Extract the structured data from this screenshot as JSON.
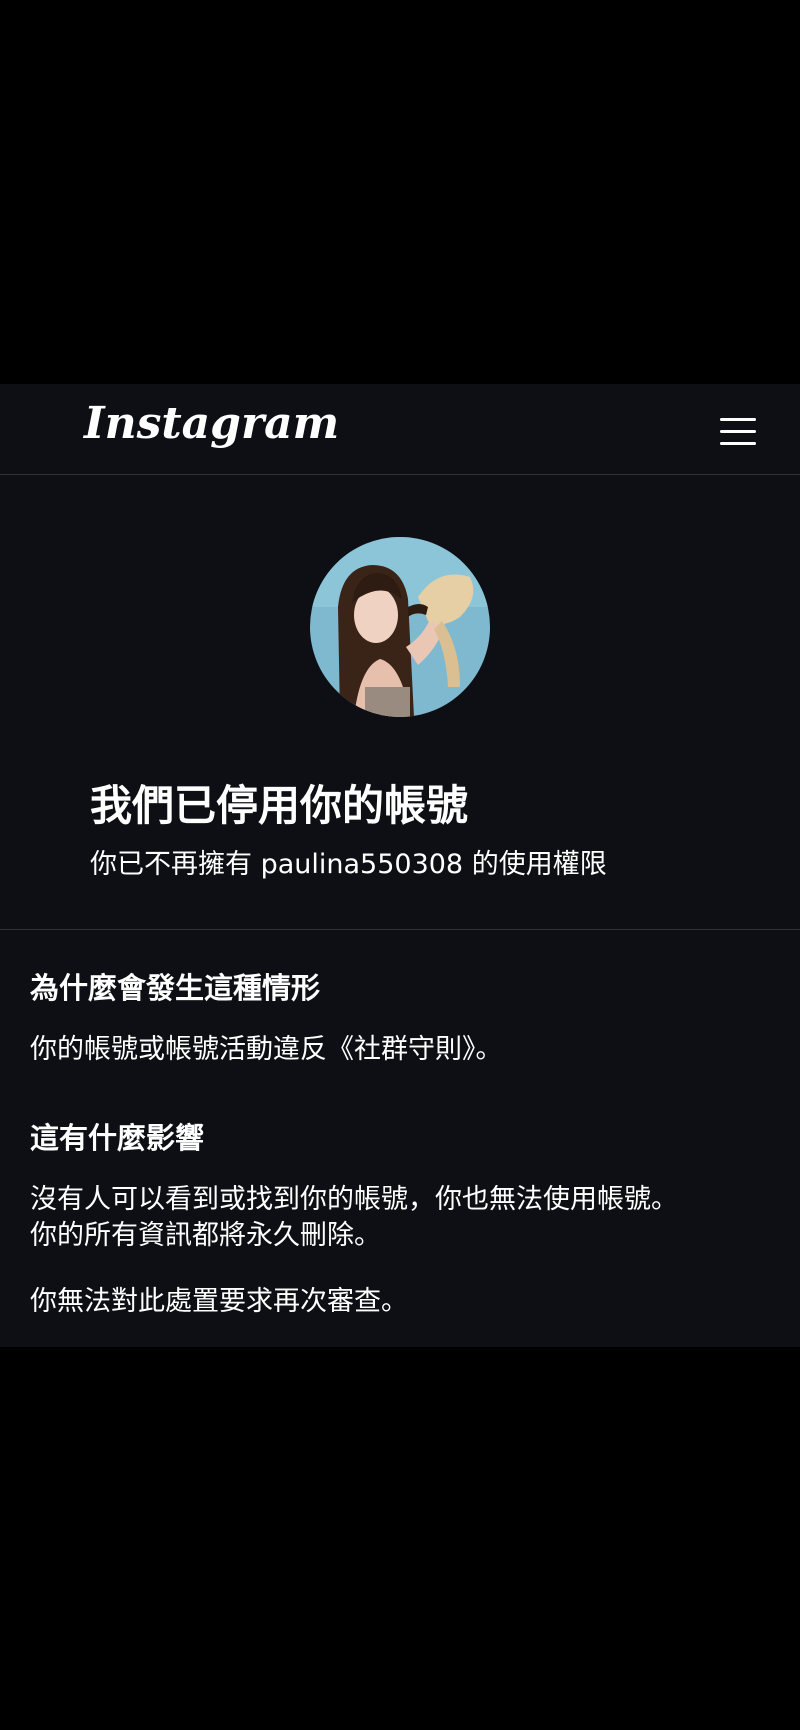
{
  "app": {
    "logo_text": "Instagram",
    "menu_icon": "hamburger-menu-icon"
  },
  "profile": {
    "avatar_alt": "profile photo"
  },
  "notice": {
    "headline": "我們已停用你的帳號",
    "subline": "你已不再擁有 paulina550308 的使用權限"
  },
  "sections": [
    {
      "title": "為什麼會發生這種情形",
      "text": "你的帳號或帳號活動違反《社群守則》。"
    },
    {
      "title": "這有什麼影響",
      "text_line1": "沒有人可以看到或找到你的帳號，你也無法使用帳號。",
      "text_line2": "你的所有資訊都將永久刪除。",
      "text_line3": "你無法對此處置要求再次審查。"
    }
  ],
  "colors": {
    "page_background": "#000000",
    "panel_background": "#0d0f14",
    "divider": "#2e3138",
    "text": "#ffffff"
  }
}
